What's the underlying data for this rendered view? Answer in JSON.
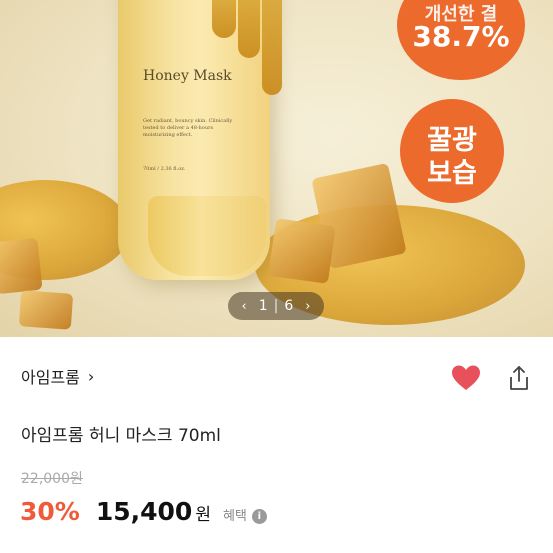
{
  "hero": {
    "product_title": "Honey Mask",
    "product_desc": "Get radiant, bouncy skin. Clinically tested to deliver a 48-hours moisturizing effect.",
    "product_volume": "70ml / 2.36 fl.oz.",
    "badge_top_line1": "개선한 결",
    "badge_top_line2": "38.7%",
    "badge_mid_line1": "꿀광",
    "badge_mid_line2": "보습",
    "pager": {
      "prev": "‹",
      "current": "1",
      "separator": "|",
      "total": "6",
      "next": "›"
    }
  },
  "shop": {
    "name": "아임프롬",
    "chevron": "›"
  },
  "product": {
    "title": "아임프롬 허니 마스크 70ml",
    "original_price": "22,000원",
    "discount": "30%",
    "price": "15,400",
    "currency": "원",
    "benefit_label": "혜택",
    "info_icon": "i"
  },
  "colors": {
    "accent": "#ef5a3a",
    "badge": "#ec6a2c",
    "heart": "#e8505b"
  }
}
